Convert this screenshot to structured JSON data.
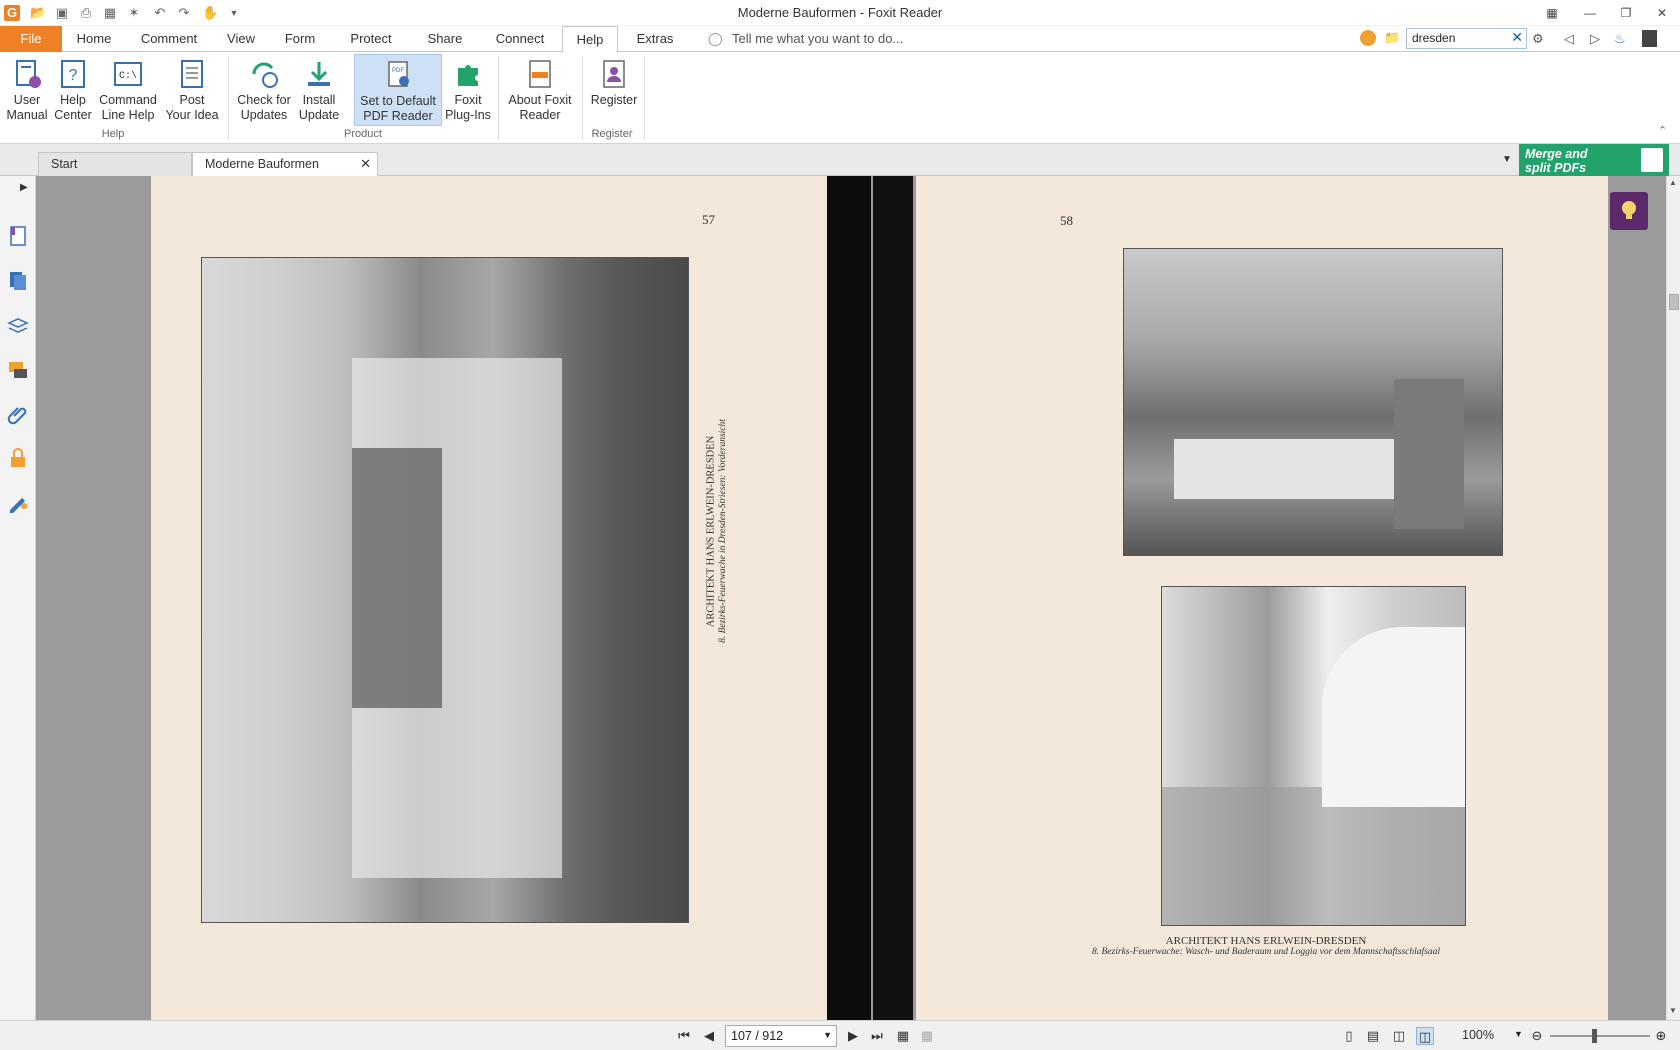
{
  "window": {
    "title": "Moderne Bauformen - Foxit Reader"
  },
  "menu": {
    "tabs": [
      "File",
      "Home",
      "Comment",
      "View",
      "Form",
      "Protect",
      "Share",
      "Connect",
      "Help",
      "Extras"
    ],
    "active": "Help",
    "tellme": "Tell me what you want to do...",
    "search_value": "dresden"
  },
  "ribbon": {
    "buttons": [
      {
        "l1": "User",
        "l2": "Manual"
      },
      {
        "l1": "Help",
        "l2": "Center"
      },
      {
        "l1": "Command",
        "l2": "Line Help"
      },
      {
        "l1": "Post",
        "l2": "Your Idea"
      },
      {
        "l1": "Check for",
        "l2": "Updates"
      },
      {
        "l1": "Install",
        "l2": "Update"
      },
      {
        "l1": "Set to Default",
        "l2": "PDF Reader"
      },
      {
        "l1": "Foxit",
        "l2": "Plug-Ins"
      },
      {
        "l1": "About Foxit",
        "l2": "Reader"
      },
      {
        "l1": "Register",
        "l2": ""
      }
    ],
    "groups": [
      "Help",
      "Product",
      "Register"
    ]
  },
  "doc_tabs": [
    "Start",
    "Moderne Bauformen"
  ],
  "banner": {
    "line1": "Merge and",
    "line2": "split PDFs"
  },
  "pages": {
    "left_number": "57",
    "right_number": "58",
    "left_caption1": "ARCHITEKT HANS ERLWEIN-DRESDEN",
    "left_caption2": "8. Bezirks-Feuerwache in Dresden-Striesen: Vorderansicht",
    "right_caption1": "ARCHITEKT HANS ERLWEIN-DRESDEN",
    "right_caption2": "8. Bezirks-Feuerwache: Wasch- und Baderaum und Loggia vor dem Mannschaftsschlafsaal"
  },
  "status": {
    "page": "107 / 912",
    "zoom": "100%"
  },
  "colors": {
    "file_tab": "#f08026",
    "banner": "#22a36c",
    "highlight": "#cde0f5",
    "lightbulb": "#5c2a6b"
  }
}
